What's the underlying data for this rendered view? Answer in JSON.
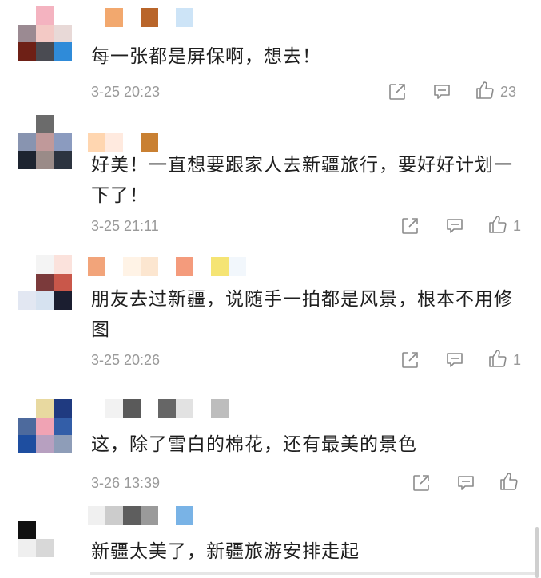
{
  "comments": [
    {
      "text": "每一张都是屏保啊，想去！",
      "time": "3-25 20:23",
      "likes": "23",
      "avatar_colors": [
        "#ffffff",
        "#f4b3c0",
        "#ffffff",
        "#9b8a92",
        "#f3c9c5",
        "#e8d9d7",
        "#6e2016",
        "#4a4b52",
        "#2f8bd9"
      ],
      "name_colors": [
        "#ffffff",
        "#f2a86e",
        "#ffffff",
        "#b9652a",
        "#ffffff",
        "#cde4f7"
      ]
    },
    {
      "text": "好美！一直想要跟家人去新疆旅行，要好好计划一下了！",
      "time": "3-25 21:11",
      "likes": "1",
      "avatar_colors": [
        "#ffffff",
        "#6b6b6b",
        "#ffffff",
        "#8894b0",
        "#c0999a",
        "#8b9bbf",
        "#1d2430",
        "#9a8b88",
        "#2c3440"
      ],
      "name_colors": [
        "#ffd6b0",
        "#ffeadf",
        "#ffffff",
        "#c98032"
      ]
    },
    {
      "text": "朋友去过新疆，说随手一拍都是风景，根本不用修图",
      "time": "3-25 20:26",
      "likes": "1",
      "avatar_colors": [
        "#ffffff",
        "#f4f4f4",
        "#fbe2dc",
        "#ffffff",
        "#7b3a3b",
        "#c9574a",
        "#e2e7f2",
        "#d6e2f0",
        "#1b1e30"
      ],
      "name_colors": [
        "#f2a47a",
        "#ffffff",
        "#fff3e6",
        "#fce6d0",
        "#ffffff",
        "#f49b7c",
        "#ffffff",
        "#f5e474",
        "#f2f7fc"
      ]
    },
    {
      "text": "这，除了雪白的棉花，还有最美的景色",
      "time": "3-26 13:39",
      "likes": "",
      "avatar_colors": [
        "#ffffff",
        "#e8d9a0",
        "#1f3a80",
        "#4d6a9d",
        "#f0a3b4",
        "#335ea8",
        "#1e4ea0",
        "#b7a0c0",
        "#8e9db8"
      ],
      "name_colors": [
        "#ffffff",
        "#f2f2f2",
        "#5a5a5a",
        "#ffffff",
        "#666666",
        "#e2e2e2",
        "#ffffff",
        "#bdbdbd"
      ]
    },
    {
      "text": "新疆太美了，新疆旅游安排走起",
      "time": "",
      "likes": "",
      "avatar_colors": [
        "#ffffff",
        "#ffffff",
        "#ffffff",
        "#111111",
        "#ffffff",
        "#ffffff",
        "#efefef",
        "#d8d8d8",
        "#ffffff"
      ],
      "name_colors": [
        "#f0f0f0",
        "#cccccc",
        "#5e5e5e",
        "#9a9a9a",
        "#ffffff",
        "#79b3e6"
      ]
    }
  ]
}
